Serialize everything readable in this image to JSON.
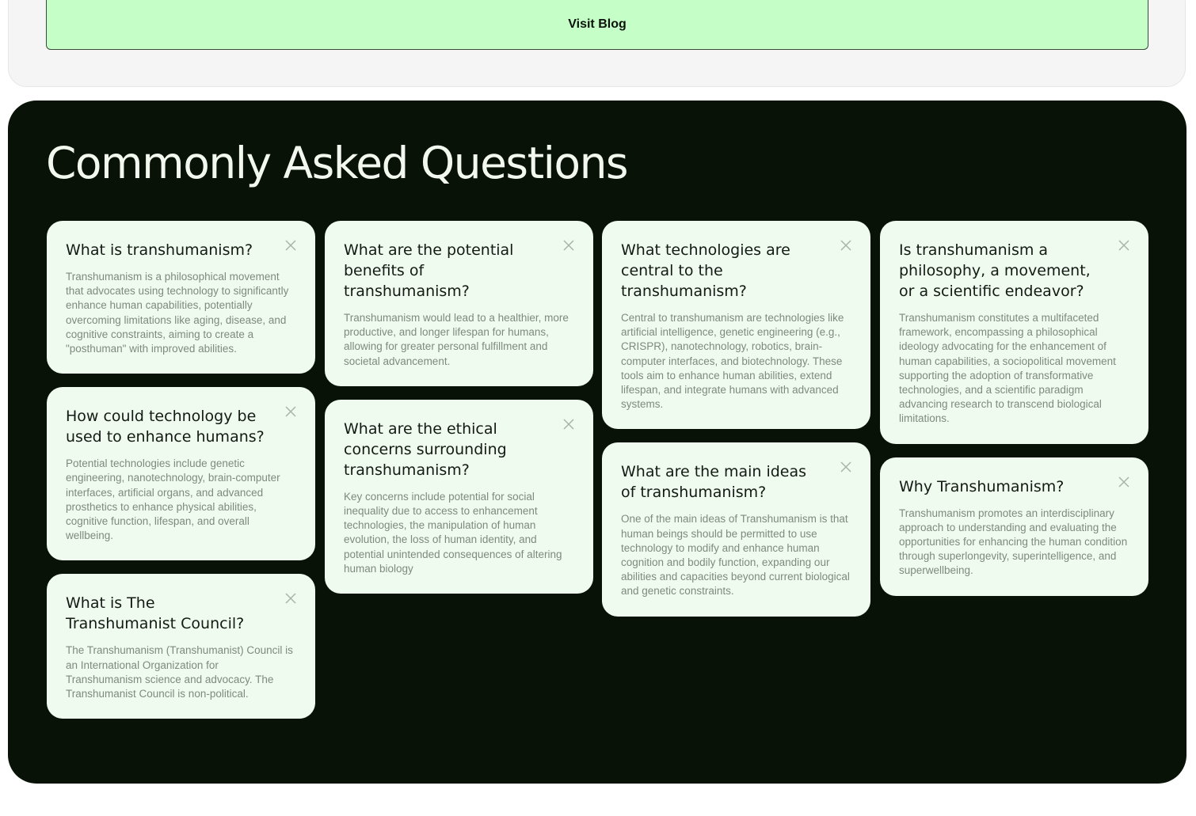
{
  "top": {
    "visit_blog_label": "Visit Blog"
  },
  "faq": {
    "title": "Commonly Asked Questions",
    "columns": [
      [
        {
          "question": "What is transhumanism?",
          "answer": "Transhumanism is a philosophical movement that advocates using technology to significantly enhance human capabilities, potentially overcoming limitations like aging, disease, and cognitive constraints, aiming to create a \"posthuman\" with improved abilities."
        },
        {
          "question": "How could technology be used to enhance humans?",
          "answer": "Potential technologies include genetic engineering, nanotechnology, brain-computer interfaces, artificial organs, and advanced prosthetics to enhance physical abilities, cognitive function, lifespan, and overall wellbeing."
        },
        {
          "question": "What is The Transhumanist Council?",
          "answer": "The Transhumanism (Transhumanist) Council is an International Organization for Transhumanism science and advocacy. The Transhumanist Council is non-political."
        }
      ],
      [
        {
          "question": "What are the potential benefits of transhumanism?",
          "answer": "Transhumanism would lead to a healthier, more productive, and longer lifespan for humans, allowing for greater personal fulfillment and societal advancement."
        },
        {
          "question": "What are the ethical concerns surrounding transhumanism?",
          "answer": "Key concerns include potential for social inequality due to access to enhancement technologies, the manipulation of human evolution, the loss of human identity, and potential unintended consequences of altering human biology"
        }
      ],
      [
        {
          "question": "What technologies are central to the transhumanism?",
          "answer": "Central to transhumanism are technologies like artificial intelligence, genetic engineering (e.g., CRISPR), nanotechnology, robotics, brain-computer interfaces, and biotechnology. These tools aim to enhance human abilities, extend lifespan, and integrate humans with advanced systems."
        },
        {
          "question": "What are the main ideas of transhumanism?",
          "answer": "One of the main ideas of Transhumanism is that human beings should be permitted to use technology to modify and enhance human cognition and bodily function, expanding our abilities and capacities beyond current biological and genetic constraints."
        }
      ],
      [
        {
          "question": "Is transhumanism a philosophy, a movement, or a scientific endeavor?",
          "answer": "Transhumanism constitutes a multifaceted framework, encompassing a philosophical ideology advocating for the enhancement of human capabilities, a sociopolitical movement supporting the adoption of transformative technologies, and a scientific paradigm advancing research to transcend biological limitations."
        },
        {
          "question": "Why Transhumanism?",
          "answer": "Transhumanism promotes an interdisciplinary approach to understanding and evaluating the opportunities for enhancing the human condition through superlongevity, superintelligence, and superwellbeing."
        }
      ]
    ]
  }
}
